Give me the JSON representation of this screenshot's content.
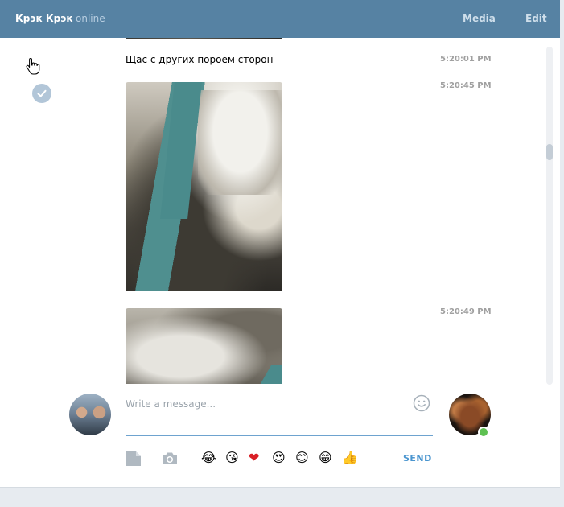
{
  "header": {
    "peer_name": "Крэк Крэк",
    "peer_status": "online",
    "media_label": "Media",
    "edit_label": "Edit"
  },
  "history": {
    "messages": [
      {
        "text": "Щас с других пороем сторон",
        "time": "5:20:01 PM"
      },
      {
        "type": "photo",
        "time": "5:20:45 PM"
      },
      {
        "type": "photo",
        "time": "5:20:49 PM"
      }
    ]
  },
  "composer": {
    "placeholder": "Write a message...",
    "send_label": "SEND",
    "emoji_quick": [
      "😂",
      "😘",
      "❤",
      "😍",
      "😊",
      "😁",
      "👍"
    ]
  },
  "icons": {
    "cursor": "hand-cursor-icon",
    "selected": "check-circle-icon",
    "file": "file-icon",
    "camera": "camera-icon",
    "emoji": "smile-icon"
  },
  "colors": {
    "header_bg": "#5682a3",
    "accent": "#4a95cf",
    "online": "#5ec152"
  }
}
